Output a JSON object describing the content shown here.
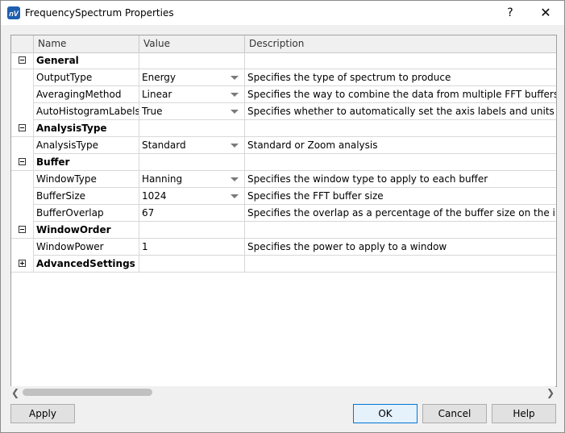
{
  "window": {
    "title": "FrequencySpectrum Properties",
    "help_glyph": "?",
    "close_glyph": "✕"
  },
  "grid": {
    "columns": [
      "Name",
      "Value",
      "Description"
    ],
    "rows": [
      {
        "kind": "category",
        "expanded": true,
        "name": "General",
        "value": "",
        "description": ""
      },
      {
        "kind": "property",
        "name": "OutputType",
        "value": "Energy",
        "dropdown": true,
        "description": "Specifies the type of spectrum to produce"
      },
      {
        "kind": "property",
        "name": "AveragingMethod",
        "value": "Linear",
        "dropdown": true,
        "description": "Specifies the way to combine the data from multiple FFT buffers"
      },
      {
        "kind": "property",
        "name": "AutoHistogramLabels",
        "value": "True",
        "dropdown": true,
        "description": "Specifies whether to automatically set the axis labels and units text or"
      },
      {
        "kind": "category",
        "expanded": true,
        "name": "AnalysisType",
        "value": "",
        "description": ""
      },
      {
        "kind": "property",
        "name": "AnalysisType",
        "value": "Standard",
        "dropdown": true,
        "description": "Standard or Zoom analysis"
      },
      {
        "kind": "category",
        "expanded": true,
        "name": "Buffer",
        "value": "",
        "description": ""
      },
      {
        "kind": "property",
        "name": "WindowType",
        "value": "Hanning",
        "dropdown": true,
        "description": "Specifies the window type to apply to each buffer"
      },
      {
        "kind": "property",
        "name": "BufferSize",
        "value": "1024",
        "dropdown": true,
        "description": "Specifies the FFT buffer size"
      },
      {
        "kind": "property",
        "name": "BufferOverlap",
        "value": "67",
        "dropdown": false,
        "description": "Specifies the overlap as a percentage of the buffer size on the input d"
      },
      {
        "kind": "category",
        "expanded": true,
        "name": "WindowOrder",
        "value": "",
        "description": ""
      },
      {
        "kind": "property",
        "name": "WindowPower",
        "value": "1",
        "dropdown": false,
        "description": "Specifies the power to apply to a window"
      },
      {
        "kind": "category",
        "expanded": false,
        "name": "AdvancedSettings",
        "value": "",
        "description": ""
      }
    ]
  },
  "buttons": {
    "apply": "Apply",
    "ok": "OK",
    "cancel": "Cancel",
    "help": "Help"
  },
  "scrollbar": {
    "left_glyph": "❮",
    "right_glyph": "❯"
  },
  "colors": {
    "logo": "#1f5fae",
    "ok_border": "#0078d7"
  }
}
